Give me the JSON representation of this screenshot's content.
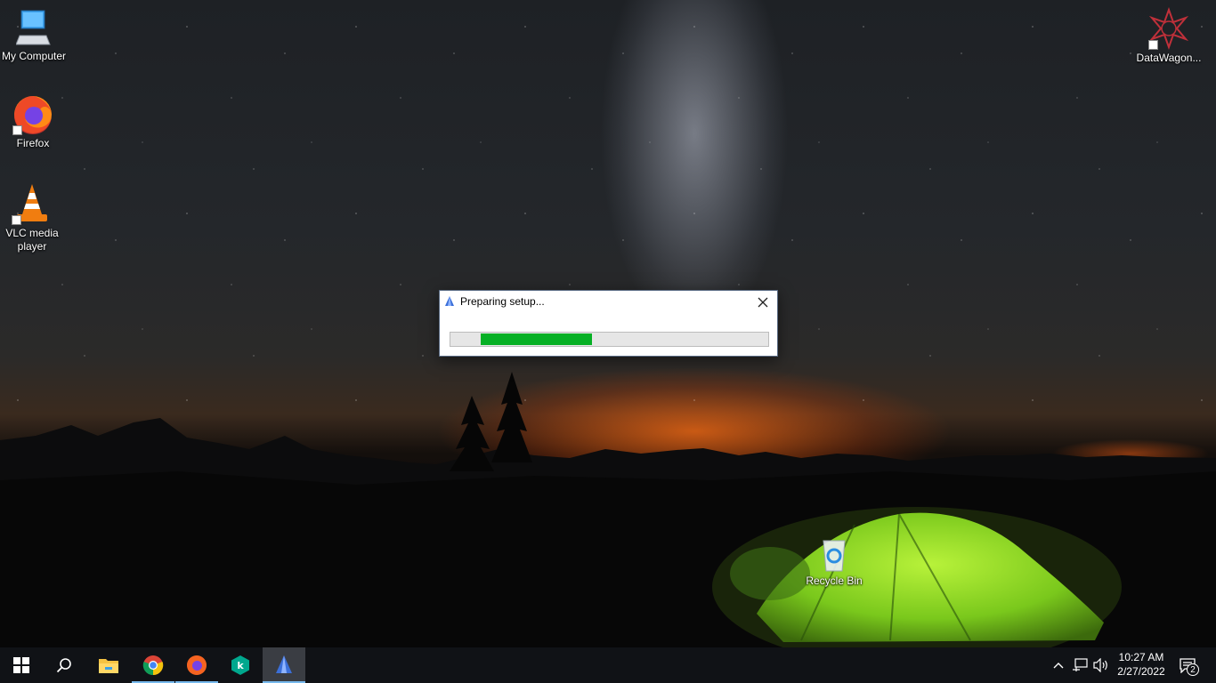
{
  "desktop": {
    "icons": [
      {
        "label": "My Computer",
        "icon": "computer-icon"
      },
      {
        "label": "Firefox",
        "icon": "firefox-icon"
      },
      {
        "label": "VLC media player",
        "icon": "vlc-icon"
      },
      {
        "label": "DataWagon...",
        "icon": "datawagon-icon"
      },
      {
        "label": "Recycle Bin",
        "icon": "recycle-bin-icon"
      }
    ]
  },
  "dialog": {
    "title": "Preparing setup...",
    "progress_fraction": 0.35,
    "colors": {
      "progress_fill": "#06b025"
    }
  },
  "taskbar": {
    "buttons": [
      {
        "name": "start",
        "icon": "windows-logo-icon"
      },
      {
        "name": "search",
        "icon": "search-icon"
      },
      {
        "name": "file-explorer",
        "icon": "folder-icon"
      },
      {
        "name": "chrome",
        "icon": "chrome-icon"
      },
      {
        "name": "firefox",
        "icon": "firefox-icon"
      },
      {
        "name": "kaspersky",
        "icon": "kaspersky-icon"
      },
      {
        "name": "setup",
        "icon": "setup-app-icon"
      }
    ],
    "clock": {
      "time": "10:27 AM",
      "date": "2/27/2022"
    },
    "notification_count": "2"
  }
}
